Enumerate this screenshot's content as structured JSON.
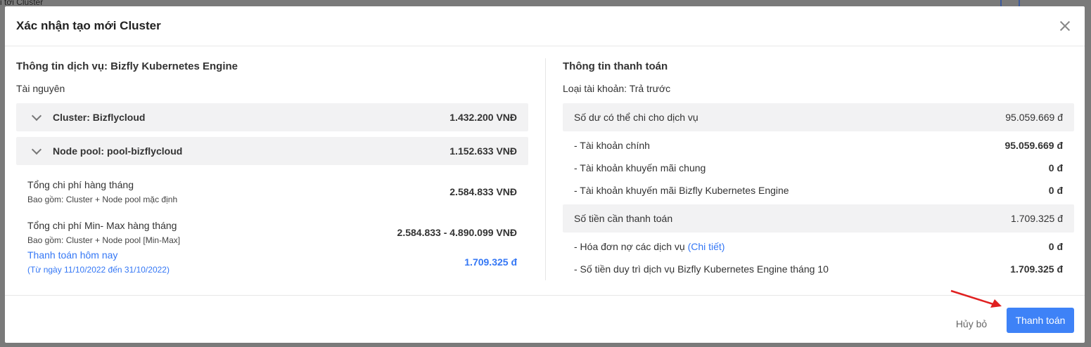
{
  "background": {
    "top_left_text": "i tới Cluster"
  },
  "modal": {
    "title": "Xác nhận tạo mới Cluster",
    "left": {
      "title": "Thông tin dịch vụ: Bizfly Kubernetes Engine",
      "subtitle": "Tài nguyên",
      "rows": [
        {
          "label": "Cluster: Bizflycloud",
          "amount": "1.432.200 VNĐ"
        },
        {
          "label": "Node pool: pool-bizflycloud",
          "amount": "1.152.633 VNĐ"
        }
      ],
      "monthly": {
        "label": "Tổng chi phí hàng tháng",
        "note": "Bao gồm: Cluster + Node pool mặc định",
        "amount": "2.584.833 VNĐ"
      },
      "minmax": {
        "label": "Tổng chi phí Min- Max hàng tháng",
        "note": "Bao gồm: Cluster + Node pool [Min-Max]",
        "amount": "2.584.833 - 4.890.099 VNĐ"
      },
      "today": {
        "label": "Thanh toán hôm nay",
        "note": "(Từ ngày 11/10/2022 đến 31/10/2022)",
        "amount": "1.709.325 đ"
      }
    },
    "right": {
      "title": "Thông tin thanh toán",
      "account_type": "Loại tài khoản: Trả trước",
      "balance": {
        "label": "Số dư có thể chi cho dịch vụ",
        "amount": "95.059.669 đ",
        "items": [
          {
            "label": "- Tài khoản chính",
            "amount": "95.059.669 đ"
          },
          {
            "label": "- Tài khoản khuyến mãi chung",
            "amount": "0 đ"
          },
          {
            "label": "- Tài khoản khuyến mãi Bizfly Kubernetes Engine",
            "amount": "0 đ"
          }
        ]
      },
      "due": {
        "label": "Số tiền cần thanh toán",
        "amount": "1.709.325 đ",
        "debt_label": "- Hóa đơn nợ các dịch vụ",
        "debt_link": "(Chi tiết)",
        "debt_amount": "0 đ",
        "maintain_label": "- Số tiền duy trì dịch vụ Bizfly Kubernetes Engine tháng 10",
        "maintain_amount": "1.709.325 đ"
      }
    },
    "footer": {
      "cancel_label": "Hủy bỏ",
      "pay_label": "Thanh toán"
    }
  },
  "colors": {
    "accent": "#3e82f7",
    "link": "#3477f5",
    "arrow": "#e02020"
  }
}
